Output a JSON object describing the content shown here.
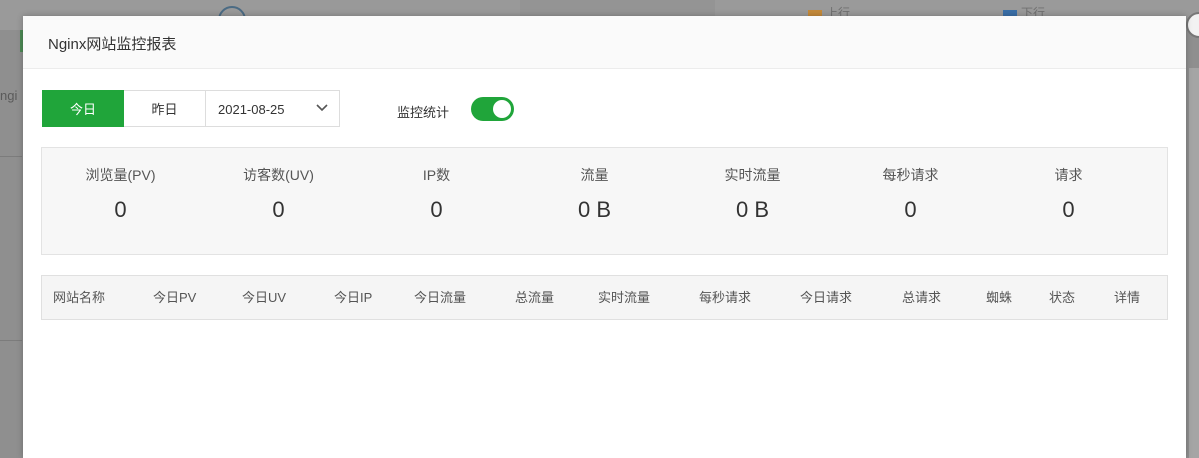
{
  "backdrop": {
    "legend_up": "上行",
    "legend_down": "下行",
    "left_fragment": "ngi",
    "colors": {
      "up": "#c58a3a",
      "down": "#3a6fa8"
    }
  },
  "modal": {
    "title": "Nginx网站监控报表",
    "tabs": {
      "today": "今日",
      "yesterday": "昨日"
    },
    "date_value": "2021-08-25",
    "monitor_label": "监控统计",
    "monitor_enabled": true,
    "accent_color": "#20a53a"
  },
  "stats": [
    {
      "label": "浏览量(PV)",
      "value": "0"
    },
    {
      "label": "访客数(UV)",
      "value": "0"
    },
    {
      "label": "IP数",
      "value": "0"
    },
    {
      "label": "流量",
      "value": "0 B"
    },
    {
      "label": "实时流量",
      "value": "0 B"
    },
    {
      "label": "每秒请求",
      "value": "0"
    },
    {
      "label": "请求",
      "value": "0"
    }
  ],
  "table": {
    "columns": [
      "网站名称",
      "今日PV",
      "今日UV",
      "今日IP",
      "今日流量",
      "总流量",
      "实时流量",
      "每秒请求",
      "今日请求",
      "总请求",
      "蜘蛛",
      "状态",
      "详情"
    ]
  }
}
